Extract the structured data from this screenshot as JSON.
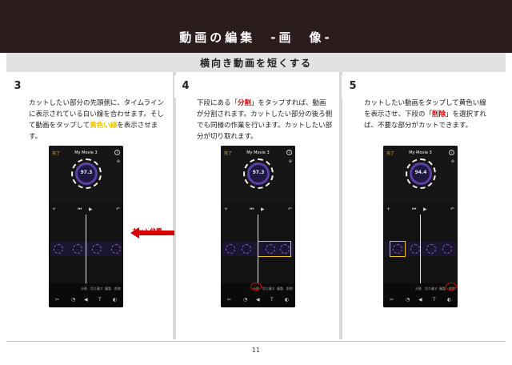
{
  "header": {
    "title": "動画の編集　-画　像-"
  },
  "subheader": {
    "title": "横向き動画を短くする"
  },
  "steps": [
    {
      "number": "3",
      "text_before": "カットしたい部分の先頭側に、タイムラインに表示されている白い線を合わせます。そして動画をタップして",
      "highlight": "黄色い線",
      "text_after": "を表示させます。",
      "annotation": "カット位置",
      "phone": {
        "done": "完了",
        "title": "My Movie 3",
        "value": "97.3"
      }
    },
    {
      "number": "4",
      "text_before": "下段にある「",
      "highlight": "分割",
      "text_after": "」をタップすれば、動画が分割されます。カットしたい部分の後ろ側でも同様の作業を行います。カットしたい部分が切り取れます。",
      "phone": {
        "done": "完了",
        "title": "My Movie 3",
        "value": "97.3"
      }
    },
    {
      "number": "5",
      "text_before": "カットしたい動画をタップして黄色い線を表示させ、下段の「",
      "highlight": "削除",
      "text_after": "」を選択すれば、不要な部分がカットできます。",
      "phone": {
        "done": "完了",
        "title": "My Movie 3",
        "value": "94.4"
      }
    }
  ],
  "phone_tabs": [
    "分割",
    "切り離す",
    "複製",
    "削除"
  ],
  "page_number": "11",
  "colors": {
    "header_bg": "#2a1d1c",
    "accent_yellow": "#e8c400",
    "accent_red": "#e00000",
    "ring": "#5b3fa8"
  }
}
